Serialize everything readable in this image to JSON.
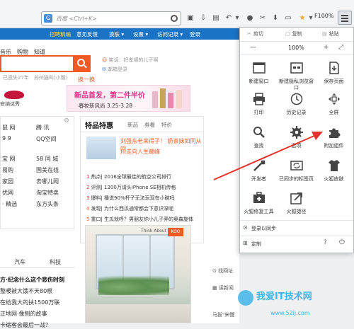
{
  "toolbar": {
    "url_placeholder": "百度 <Ctrl+K>",
    "zoom_label": "F100%",
    "icons": [
      "nav-back-icon",
      "bookmark-icon",
      "grid-icon",
      "undo-icon",
      "redo-icon",
      "chat-icon",
      "scissors-icon",
      "download-icon",
      "tab-icon",
      "addon-icon"
    ]
  },
  "page": {
    "navbar": [
      "招聘精编",
      "意见反馈",
      "换肤 ▾",
      "设置 ▾",
      "访问记录 ▾",
      "登录"
    ],
    "top_cats": "音乐　购物　知道",
    "weather_hint": "已遗失27年　苏州猫叫(小猴)",
    "side_hint": "笑话：好孝顺的儿子啊",
    "mail_hint": "邮箱登录",
    "refresh": "换一换",
    "banner_title": "新品首发，第二件半价",
    "banner_sub": "春妆新风尚 3.25-3.28",
    "banner_brand": "安纳达秀",
    "box_left_rows": [
      {
        "a": "鼠 网",
        "b": "腾 讯"
      },
      {
        "a": "9 9",
        "b": "QQ空间"
      },
      {
        "a": "",
        "b": ""
      },
      {
        "a": "宝 网",
        "b": "58 同 城"
      },
      {
        "a": "易购",
        "b": "国美在线"
      },
      {
        "a": "家园",
        "b": "去哪儿网"
      },
      {
        "a": "优网",
        "b": "淘宝特卖"
      },
      {
        "a": "· 精选",
        "b": "东方头条"
      }
    ],
    "box_mid": {
      "tab_main": "特品特惠",
      "tabs": [
        "新品",
        "券看",
        "特价"
      ],
      "feat1": "刘强东老来得子！",
      "feat1b": "奶茶妹如同从回",
      "feat2": "川走向人生巅峰",
      "news": [
        {
          "n": "1",
          "t": "热点| 2016全球最佳的航空公司排行"
        },
        {
          "n": "2",
          "t": "评测| 1200万请头iPhone SE相机传格"
        },
        {
          "n": "3",
          "t": "爆料| 播说90%杯子无法玩现在小碗吗"
        },
        {
          "n": "4",
          "t": "发现| 为什么西瓜通常都会下意识深呢"
        },
        {
          "n": "5",
          "t": "重口| 生瓜就呼？男朋友你小儿子弄的奥森旋体"
        }
      ]
    },
    "tabs2": [
      "汽车",
      "科技"
    ],
    "left_news": [
      "方·纪念什么这个悲伤时刻",
      "整暖被大饿不天80根",
      "在给我大的扶1500万联",
      "正地网·像刨的故事",
      "卡缩客会最后一战？"
    ],
    "photo_logo": "KOO",
    "photo_logo_text": "Think About",
    "right_mini": [
      "找网址",
      "读新闻",
      "马拔\"宋慢"
    ]
  },
  "menu": {
    "top": [
      {
        "icon": "cut-icon",
        "label": "剪切"
      },
      {
        "icon": "copy-icon",
        "label": "复制"
      },
      {
        "icon": "paste-icon",
        "label": "粘贴"
      }
    ],
    "zoom": {
      "minus": "—",
      "pct": "100%",
      "plus": "+"
    },
    "items": [
      {
        "icon": "new-window-icon",
        "label": "新建窗口"
      },
      {
        "icon": "private-window-icon",
        "label": "新建隐私浏览窗口"
      },
      {
        "icon": "save-page-icon",
        "label": "保存页面"
      },
      {
        "icon": "print-icon",
        "label": "打印"
      },
      {
        "icon": "history-icon",
        "label": "历史记录"
      },
      {
        "icon": "fullscreen-icon",
        "label": "全屏"
      },
      {
        "icon": "find-icon",
        "label": "查找"
      },
      {
        "icon": "options-icon",
        "label": "选项"
      },
      {
        "icon": "addons-icon",
        "label": "附加组件"
      },
      {
        "icon": "developer-icon",
        "label": "开发者"
      },
      {
        "icon": "synced-tabs-icon",
        "label": "已同步的标签页"
      },
      {
        "icon": "themes-icon",
        "label": "火狐皮肤"
      },
      {
        "icon": "repair-tool-icon",
        "label": "火狐修复工具"
      },
      {
        "icon": "shortcut-icon",
        "label": "火狐捷径"
      }
    ],
    "sync": "登录以同步",
    "customize": "定制",
    "colors": {
      "accent": "#1a73c5",
      "arrow": "#e8312c"
    }
  },
  "watermark": {
    "line1": "我爱IT技术网",
    "line2": "www.52ij.com"
  }
}
